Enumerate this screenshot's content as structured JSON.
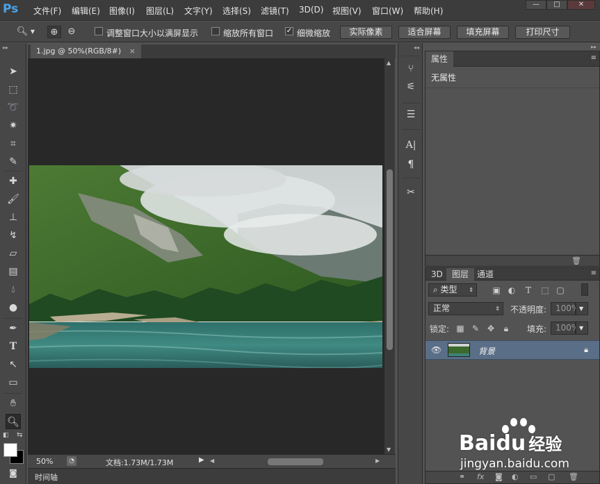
{
  "app": {
    "logo": "Ps"
  },
  "menu": [
    "文件(F)",
    "编辑(E)",
    "图像(I)",
    "图层(L)",
    "文字(Y)",
    "选择(S)",
    "滤镜(T)",
    "3D(D)",
    "视图(V)",
    "窗口(W)",
    "帮助(H)"
  ],
  "window_controls": {
    "minimize": "—",
    "maximize": "□",
    "close": "✕"
  },
  "options": {
    "resize_windows_label": "调整窗口大小以满屏显示",
    "resize_windows_checked": false,
    "zoom_all_label": "缩放所有窗口",
    "zoom_all_checked": false,
    "scrubby_zoom_label": "细微缩放",
    "scrubby_zoom_checked": true,
    "actual_pixels": "实际像素",
    "fit_screen": "适合屏幕",
    "fill_screen": "填充屏幕",
    "print_size": "打印尺寸"
  },
  "document": {
    "tab_title": "1.jpg @ 50%(RGB/8#)",
    "tab_close": "×",
    "zoom": "50%",
    "doc_info": "文档:1.73M/1.73M"
  },
  "timeline": {
    "label": "时间轴"
  },
  "properties": {
    "tab": "属性",
    "content": "无属性"
  },
  "layers": {
    "tabs": [
      "3D",
      "图层",
      "通道"
    ],
    "active_tab": "图层",
    "filter_kind": "类型",
    "blend_mode": "正常",
    "opacity_label": "不透明度:",
    "opacity_value": "100%",
    "lock_label": "锁定:",
    "fill_label": "填充:",
    "fill_value": "100%",
    "items": [
      {
        "name": "背景",
        "visible": true,
        "locked": true
      }
    ]
  },
  "watermark": {
    "brand": "Baidu",
    "brand_cn": "经验",
    "url": "jingyan.baidu.com"
  },
  "colors": {
    "accent": "#4aa3e8",
    "selected_layer": "#5a6e87",
    "ui_dark": "#282828",
    "ui_panel": "#535353"
  }
}
